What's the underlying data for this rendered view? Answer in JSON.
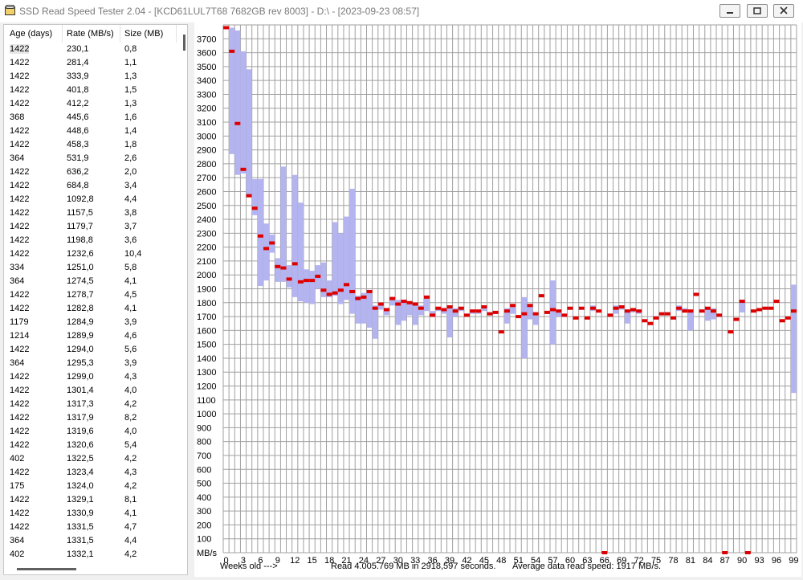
{
  "window": {
    "title": "SSD Read Speed Tester 2.04 - [KCD61LUL7T68 7682GB rev 8003] - D:\\ - [2023-09-23 08:57]",
    "app_icon": "folder-icon",
    "buttons": [
      "minimize-icon",
      "maximize-icon",
      "close-icon"
    ]
  },
  "list": {
    "columns": [
      "Age (days)",
      "Rate (MB/s)",
      "Size (MB)"
    ],
    "rows": [
      [
        "1422",
        "230,1",
        "0,8"
      ],
      [
        "1422",
        "281,4",
        "1,1"
      ],
      [
        "1422",
        "333,9",
        "1,3"
      ],
      [
        "1422",
        "401,8",
        "1,5"
      ],
      [
        "1422",
        "412,2",
        "1,3"
      ],
      [
        "368",
        "445,6",
        "1,6"
      ],
      [
        "1422",
        "448,6",
        "1,4"
      ],
      [
        "1422",
        "458,3",
        "1,8"
      ],
      [
        "364",
        "531,9",
        "2,6"
      ],
      [
        "1422",
        "636,2",
        "2,0"
      ],
      [
        "1422",
        "684,8",
        "3,4"
      ],
      [
        "1422",
        "1092,8",
        "4,4"
      ],
      [
        "1422",
        "1157,5",
        "3,8"
      ],
      [
        "1422",
        "1179,7",
        "3,7"
      ],
      [
        "1422",
        "1198,8",
        "3,6"
      ],
      [
        "1422",
        "1232,6",
        "10,4"
      ],
      [
        "334",
        "1251,0",
        "5,8"
      ],
      [
        "364",
        "1274,5",
        "4,1"
      ],
      [
        "1422",
        "1278,7",
        "4,5"
      ],
      [
        "1422",
        "1282,8",
        "4,1"
      ],
      [
        "1179",
        "1284,9",
        "3,9"
      ],
      [
        "1214",
        "1289,9",
        "4,6"
      ],
      [
        "1422",
        "1294,0",
        "5,6"
      ],
      [
        "364",
        "1295,3",
        "3,9"
      ],
      [
        "1422",
        "1299,0",
        "4,3"
      ],
      [
        "1422",
        "1301,4",
        "4,0"
      ],
      [
        "1422",
        "1317,3",
        "4,2"
      ],
      [
        "1422",
        "1317,9",
        "8,2"
      ],
      [
        "1422",
        "1319,6",
        "4,0"
      ],
      [
        "1422",
        "1320,6",
        "5,4"
      ],
      [
        "402",
        "1322,5",
        "4,2"
      ],
      [
        "1422",
        "1323,4",
        "4,3"
      ],
      [
        "175",
        "1324,0",
        "4,2"
      ],
      [
        "1422",
        "1329,1",
        "8,1"
      ],
      [
        "1422",
        "1330,9",
        "4,1"
      ],
      [
        "1422",
        "1331,5",
        "4,7"
      ],
      [
        "364",
        "1331,5",
        "4,4"
      ],
      [
        "402",
        "1332,1",
        "4,2"
      ]
    ]
  },
  "footer": {
    "xaxis_label": "Weeks old --->",
    "read_summary": "Read 4.005.769 MB in 2918,597 seconds.",
    "avg_speed": "Average data read speed: 1917 MB/s."
  },
  "chart_data": {
    "type": "bar",
    "ylabel": "MB/s",
    "xlabel": "Weeks old --->",
    "ylim": [
      0,
      3800
    ],
    "yticks": [
      100,
      200,
      300,
      400,
      500,
      600,
      700,
      800,
      900,
      1000,
      1100,
      1200,
      1300,
      1400,
      1500,
      1600,
      1700,
      1800,
      1900,
      2000,
      2100,
      2200,
      2300,
      2400,
      2500,
      2600,
      2700,
      2800,
      2900,
      3000,
      3100,
      3200,
      3300,
      3400,
      3500,
      3600,
      3700
    ],
    "xlim": [
      0,
      99
    ],
    "xticks": [
      0,
      3,
      6,
      9,
      12,
      15,
      18,
      21,
      24,
      27,
      30,
      33,
      36,
      39,
      42,
      45,
      48,
      51,
      54,
      57,
      60,
      63,
      66,
      69,
      72,
      75,
      78,
      81,
      84,
      87,
      90,
      93,
      96,
      99
    ],
    "grid": true,
    "colors": {
      "range": "#b4b4f0",
      "mean": "#dd0000",
      "grid": "#a0a0a0"
    },
    "series": [
      {
        "name": "",
        "points": [
          [
            0,
            3780,
            3780,
            3780
          ],
          [
            1,
            2870,
            3780,
            3610
          ],
          [
            2,
            2720,
            3760,
            3090
          ],
          [
            3,
            2730,
            3610,
            2760
          ],
          [
            4,
            2560,
            3480,
            2570
          ],
          [
            5,
            2430,
            2690,
            2480
          ],
          [
            6,
            1920,
            2690,
            2280
          ],
          [
            7,
            1960,
            2370,
            2190
          ],
          [
            8,
            2160,
            2290,
            2230
          ],
          [
            9,
            1950,
            2120,
            2060
          ],
          [
            10,
            1950,
            2780,
            2050
          ],
          [
            11,
            1910,
            2070,
            1970
          ],
          [
            12,
            1840,
            2720,
            2080
          ],
          [
            13,
            1810,
            2520,
            1950
          ],
          [
            14,
            1800,
            2040,
            1960
          ],
          [
            15,
            1790,
            2030,
            1960
          ],
          [
            16,
            1900,
            2070,
            1990
          ],
          [
            17,
            1840,
            2090,
            1890
          ],
          [
            18,
            1840,
            1960,
            1860
          ],
          [
            19,
            1850,
            2380,
            1870
          ],
          [
            20,
            1790,
            2300,
            1890
          ],
          [
            21,
            1820,
            2420,
            1930
          ],
          [
            22,
            1720,
            2620,
            1880
          ],
          [
            23,
            1650,
            1850,
            1830
          ],
          [
            24,
            1650,
            1870,
            1840
          ],
          [
            25,
            1620,
            1890,
            1880
          ],
          [
            26,
            1540,
            1780,
            1760
          ],
          [
            27,
            1750,
            1800,
            1790
          ],
          [
            28,
            1710,
            1760,
            1750
          ],
          [
            29,
            1780,
            1840,
            1830
          ],
          [
            30,
            1640,
            1820,
            1790
          ],
          [
            31,
            1670,
            1810,
            1810
          ],
          [
            32,
            1710,
            1800,
            1800
          ],
          [
            33,
            1640,
            1790,
            1790
          ],
          [
            34,
            1710,
            1780,
            1760
          ],
          [
            35,
            1740,
            1850,
            1840
          ],
          [
            36,
            1700,
            1740,
            1710
          ],
          [
            37,
            1740,
            1770,
            1760
          ],
          [
            38,
            1720,
            1760,
            1750
          ],
          [
            39,
            1550,
            1780,
            1770
          ],
          [
            40,
            1700,
            1760,
            1740
          ],
          [
            41,
            1740,
            1770,
            1760
          ],
          [
            42,
            1700,
            1720,
            1710
          ],
          [
            43,
            1720,
            1750,
            1740
          ],
          [
            44,
            1720,
            1740,
            1740
          ],
          [
            45,
            1740,
            1770,
            1770
          ],
          [
            46,
            1710,
            1730,
            1720
          ],
          [
            47,
            1720,
            1740,
            1730
          ],
          [
            48,
            1580,
            1600,
            1590
          ],
          [
            49,
            1650,
            1760,
            1740
          ],
          [
            50,
            1720,
            1790,
            1780
          ],
          [
            51,
            1690,
            1700,
            1700
          ],
          [
            52,
            1400,
            1840,
            1720
          ],
          [
            53,
            1680,
            1790,
            1780
          ],
          [
            54,
            1640,
            1720,
            1720
          ],
          [
            55,
            1850,
            1860,
            1850
          ],
          [
            56,
            1720,
            1740,
            1730
          ],
          [
            57,
            1500,
            1960,
            1750
          ],
          [
            58,
            1700,
            1750,
            1740
          ],
          [
            59,
            1700,
            1710,
            1710
          ],
          [
            60,
            1750,
            1760,
            1760
          ],
          [
            61,
            1690,
            1700,
            1690
          ],
          [
            62,
            1750,
            1770,
            1760
          ],
          [
            63,
            1690,
            1700,
            1690
          ],
          [
            64,
            1740,
            1780,
            1760
          ],
          [
            65,
            1730,
            1740,
            1740
          ],
          [
            66,
            0,
            0,
            0
          ],
          [
            67,
            1700,
            1720,
            1710
          ],
          [
            68,
            1720,
            1780,
            1760
          ],
          [
            69,
            1750,
            1780,
            1770
          ],
          [
            70,
            1650,
            1750,
            1740
          ],
          [
            71,
            1730,
            1760,
            1750
          ],
          [
            72,
            1720,
            1750,
            1740
          ],
          [
            73,
            1670,
            1680,
            1670
          ],
          [
            74,
            1650,
            1660,
            1650
          ],
          [
            75,
            1690,
            1700,
            1690
          ],
          [
            76,
            1720,
            1730,
            1720
          ],
          [
            77,
            1710,
            1730,
            1720
          ],
          [
            78,
            1680,
            1690,
            1690
          ],
          [
            79,
            1740,
            1780,
            1760
          ],
          [
            80,
            1730,
            1760,
            1740
          ],
          [
            81,
            1600,
            1740,
            1740
          ],
          [
            82,
            1850,
            1860,
            1860
          ],
          [
            83,
            1730,
            1750,
            1740
          ],
          [
            84,
            1670,
            1770,
            1760
          ],
          [
            85,
            1680,
            1760,
            1740
          ],
          [
            86,
            1700,
            1720,
            1710
          ],
          [
            87,
            0,
            0,
            0
          ],
          [
            88,
            1580,
            1600,
            1590
          ],
          [
            89,
            1680,
            1690,
            1680
          ],
          [
            90,
            1730,
            1820,
            1810
          ],
          [
            91,
            0,
            0,
            0
          ],
          [
            92,
            1740,
            1750,
            1740
          ],
          [
            93,
            1750,
            1760,
            1750
          ],
          [
            94,
            1760,
            1770,
            1760
          ],
          [
            95,
            1760,
            1770,
            1760
          ],
          [
            96,
            1800,
            1820,
            1810
          ],
          [
            97,
            1670,
            1680,
            1670
          ],
          [
            98,
            1690,
            1700,
            1690
          ],
          [
            99,
            1150,
            1930,
            1740
          ]
        ]
      }
    ]
  }
}
